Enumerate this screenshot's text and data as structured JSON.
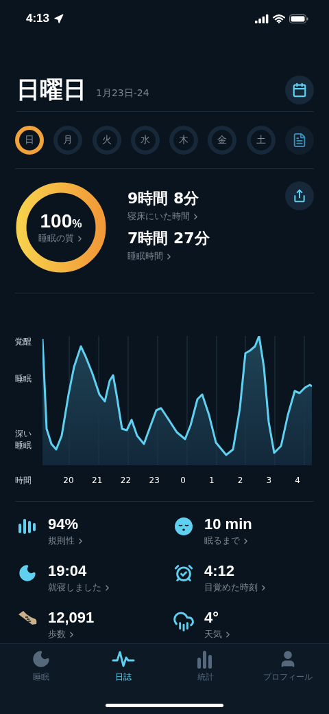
{
  "status_bar": {
    "time": "4:13"
  },
  "header": {
    "title": "日曜日",
    "date_range": "1月23日-24"
  },
  "days": [
    {
      "label": "日",
      "selected": true
    },
    {
      "label": "月",
      "selected": false
    },
    {
      "label": "火",
      "selected": false
    },
    {
      "label": "水",
      "selected": false
    },
    {
      "label": "木",
      "selected": false
    },
    {
      "label": "金",
      "selected": false
    },
    {
      "label": "土",
      "selected": false
    }
  ],
  "summary": {
    "quality": {
      "value": "100",
      "unit": "%",
      "label": "睡眠の質"
    },
    "metrics": [
      {
        "value": "9時間 8分",
        "label": "寝床にいた時間"
      },
      {
        "value": "7時間 27分",
        "label": "睡眠時間"
      }
    ]
  },
  "chart": {
    "y_labels": [
      "覚醒",
      "睡眠",
      "深い睡眠"
    ],
    "x_axis_label": "時間",
    "x_labels": [
      "20",
      "21",
      "22",
      "23",
      "0",
      "1",
      "2",
      "3",
      "4"
    ]
  },
  "stats": [
    {
      "kind": "regularity",
      "value": "94%",
      "label": "規則性"
    },
    {
      "kind": "fall_asleep",
      "value": "10 min",
      "label": "眠るまで"
    },
    {
      "kind": "bedtime",
      "value": "19:04",
      "label": "就寝しました"
    },
    {
      "kind": "wake",
      "value": "4:12",
      "label": "目覚めた時刻"
    },
    {
      "kind": "steps",
      "value": "12,091",
      "label": "歩数"
    },
    {
      "kind": "weather",
      "value": "4°",
      "label": "天気"
    }
  ],
  "tab_bar": [
    {
      "kind": "sleep",
      "label": "睡眠",
      "selected": false
    },
    {
      "kind": "journal",
      "label": "日誌",
      "selected": true
    },
    {
      "kind": "stats",
      "label": "統計",
      "selected": false
    },
    {
      "kind": "profile",
      "label": "プロフィール",
      "selected": false
    }
  ]
}
